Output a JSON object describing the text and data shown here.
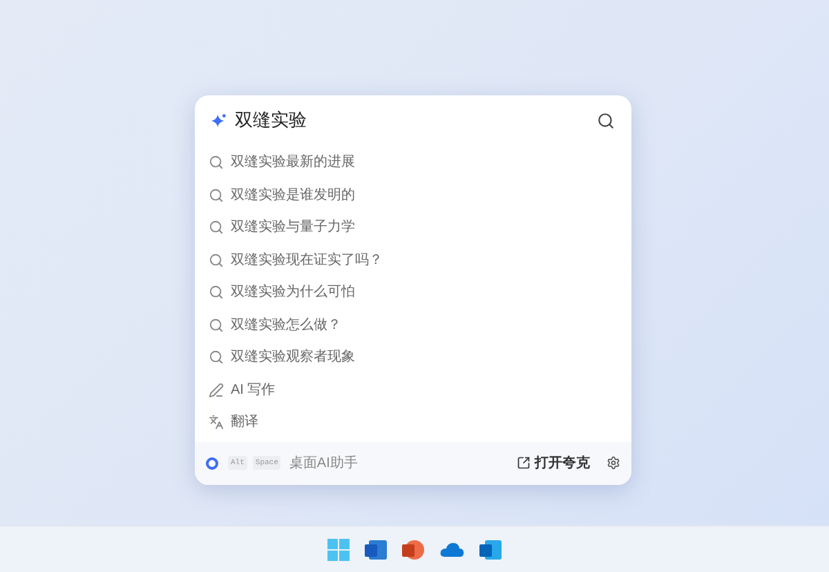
{
  "search": {
    "value": "双缝实验"
  },
  "suggestions": [
    {
      "kind": "search",
      "label": "双缝实验最新的进展"
    },
    {
      "kind": "search",
      "label": "双缝实验是谁发明的"
    },
    {
      "kind": "search",
      "label": "双缝实验与量子力学"
    },
    {
      "kind": "search",
      "label": "双缝实验现在证实了吗？"
    },
    {
      "kind": "search",
      "label": "双缝实验为什么可怕"
    },
    {
      "kind": "search",
      "label": "双缝实验怎么做？"
    },
    {
      "kind": "search",
      "label": "双缝实验观察者现象"
    },
    {
      "kind": "write",
      "label": "AI 写作"
    },
    {
      "kind": "translate",
      "label": "翻译"
    }
  ],
  "footer": {
    "keys": [
      "Alt",
      "Space"
    ],
    "label": "桌面AI助手",
    "open_button": "打开夸克"
  },
  "taskbar": [
    {
      "kind": "windows"
    },
    {
      "kind": "word"
    },
    {
      "kind": "powerpoint"
    },
    {
      "kind": "onedrive"
    },
    {
      "kind": "outlook"
    }
  ]
}
